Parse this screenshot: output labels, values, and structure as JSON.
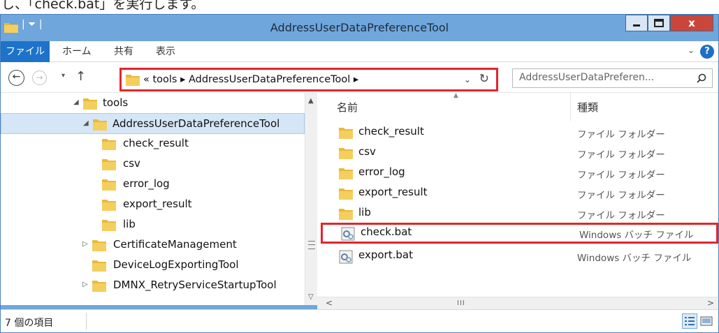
{
  "caption": "し、「check.bat」を実行します。",
  "window": {
    "title": "AddressUserDataPreferenceTool",
    "quick_access": "| ⏷ |",
    "controls": {
      "minimize": "–",
      "maximize": "□",
      "close": "x"
    }
  },
  "ribbon": {
    "tabs": [
      "ファイル",
      "ホーム",
      "共有",
      "表示"
    ],
    "expand": "⌄",
    "help": "?"
  },
  "navigation": {
    "back": "←",
    "forward": "→",
    "recent": "▾",
    "up": "↑",
    "address_path": "« tools ▸ AddressUserDataPreferenceTool ▸",
    "address_dropdown": "⌄",
    "refresh": "↻",
    "search_placeholder": "AddressUserDataPreferen..."
  },
  "tree": {
    "items": [
      {
        "label": "tools",
        "arrow": "◢",
        "selected": false
      },
      {
        "label": "AddressUserDataPreferenceTool",
        "arrow": "◢",
        "selected": true
      },
      {
        "label": "check_result",
        "arrow": "",
        "selected": false
      },
      {
        "label": "csv",
        "arrow": "",
        "selected": false
      },
      {
        "label": "error_log",
        "arrow": "",
        "selected": false
      },
      {
        "label": "export_result",
        "arrow": "",
        "selected": false
      },
      {
        "label": "lib",
        "arrow": "",
        "selected": false
      },
      {
        "label": "CertificateManagement",
        "arrow": "▷",
        "selected": false
      },
      {
        "label": "DeviceLogExportingTool",
        "arrow": "",
        "selected": false
      },
      {
        "label": "DMNX_RetryServiceStartupTool",
        "arrow": "▷",
        "selected": false
      }
    ]
  },
  "file_list": {
    "columns": {
      "name": "名前",
      "type": "種類"
    },
    "sort_indicator": "▲",
    "rows": [
      {
        "name": "check_result",
        "type": "ファイル フォルダー",
        "kind": "folder"
      },
      {
        "name": "csv",
        "type": "ファイル フォルダー",
        "kind": "folder"
      },
      {
        "name": "error_log",
        "type": "ファイル フォルダー",
        "kind": "folder"
      },
      {
        "name": "export_result",
        "type": "ファイル フォルダー",
        "kind": "folder"
      },
      {
        "name": "lib",
        "type": "ファイル フォルダー",
        "kind": "folder"
      },
      {
        "name": "check.bat",
        "type": "Windows バッチ ファイル",
        "kind": "batch"
      },
      {
        "name": "export.bat",
        "type": "Windows バッチ ファイル",
        "kind": "batch"
      }
    ]
  },
  "scrollbars": {
    "up": "▲",
    "down": "▽",
    "left": "<",
    "right": ">",
    "grip": "III"
  },
  "status": {
    "item_count": "7 個の項目"
  },
  "colors": {
    "titlebar": "#6fa6dc",
    "highlight_box": "#e1262c",
    "file_tab": "#1d73c9",
    "selection": "#d5e6f7",
    "folder": "#e8b93c"
  }
}
